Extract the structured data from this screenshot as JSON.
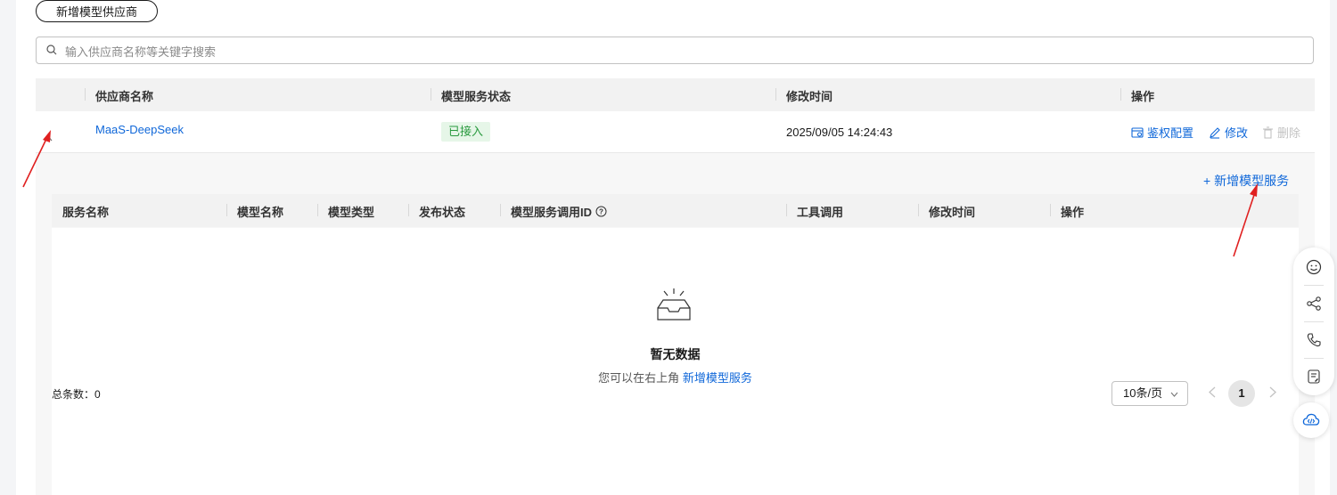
{
  "toolbar": {
    "add_provider_label": "新增模型供应商"
  },
  "search": {
    "placeholder": "输入供应商名称等关键字搜索",
    "value": ""
  },
  "provider_table": {
    "columns": [
      "供应商名称",
      "模型服务状态",
      "修改时间",
      "操作"
    ],
    "rows": [
      {
        "name": "MaaS-DeepSeek",
        "status": "已接入",
        "modified": "2025/09/05 14:24:43",
        "actions": [
          "鉴权配置",
          "修改",
          "删除"
        ]
      }
    ]
  },
  "service_panel": {
    "add_label": "+ 新增模型服务",
    "columns": [
      "服务名称",
      "模型名称",
      "模型类型",
      "发布状态",
      "模型服务调用ID",
      "工具调用",
      "修改时间",
      "操作"
    ],
    "empty_title": "暂无数据",
    "empty_desc_prefix": "您可以在右上角",
    "empty_desc_link": "新增模型服务",
    "total_label": "总条数：0",
    "page_size": "10条/页",
    "current_page": "1"
  },
  "colors": {
    "link": "#0f67d9",
    "status_ok_bg": "#e6f6e8",
    "status_ok_text": "#2a9a3f",
    "annotation": "#e02020"
  },
  "float_toolbar": {
    "icons": [
      "smile-icon",
      "share-icon",
      "phone-icon",
      "feedback-icon",
      "cloud-code-icon"
    ]
  }
}
